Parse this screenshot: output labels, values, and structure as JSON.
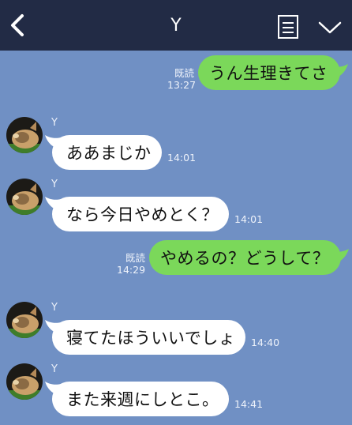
{
  "header": {
    "title": "Y"
  },
  "colors": {
    "header_bg": "#222b45",
    "chat_bg": "#7090c4",
    "sent_bubble": "#7bd85a",
    "received_bubble": "#ffffff"
  },
  "icons": {
    "back": "chevron-left-icon",
    "notes": "notes-icon",
    "menu": "chevron-down-icon"
  },
  "messages": [
    {
      "direction": "sent",
      "text": "うん生理きてさ",
      "read_label": "既読",
      "time": "13:27"
    },
    {
      "direction": "received",
      "sender": "Y",
      "text": "ああまじか",
      "time": "14:01"
    },
    {
      "direction": "received",
      "sender": "Y",
      "text": "なら今日やめとく？",
      "time": "14:01"
    },
    {
      "direction": "sent",
      "text": "やめるの？どうして？",
      "read_label": "既読",
      "time": "14:29"
    },
    {
      "direction": "received",
      "sender": "Y",
      "text": "寝てたほういいでしょ",
      "time": "14:40"
    },
    {
      "direction": "received",
      "sender": "Y",
      "text": "また来週にしとこ。",
      "time": "14:41"
    }
  ]
}
